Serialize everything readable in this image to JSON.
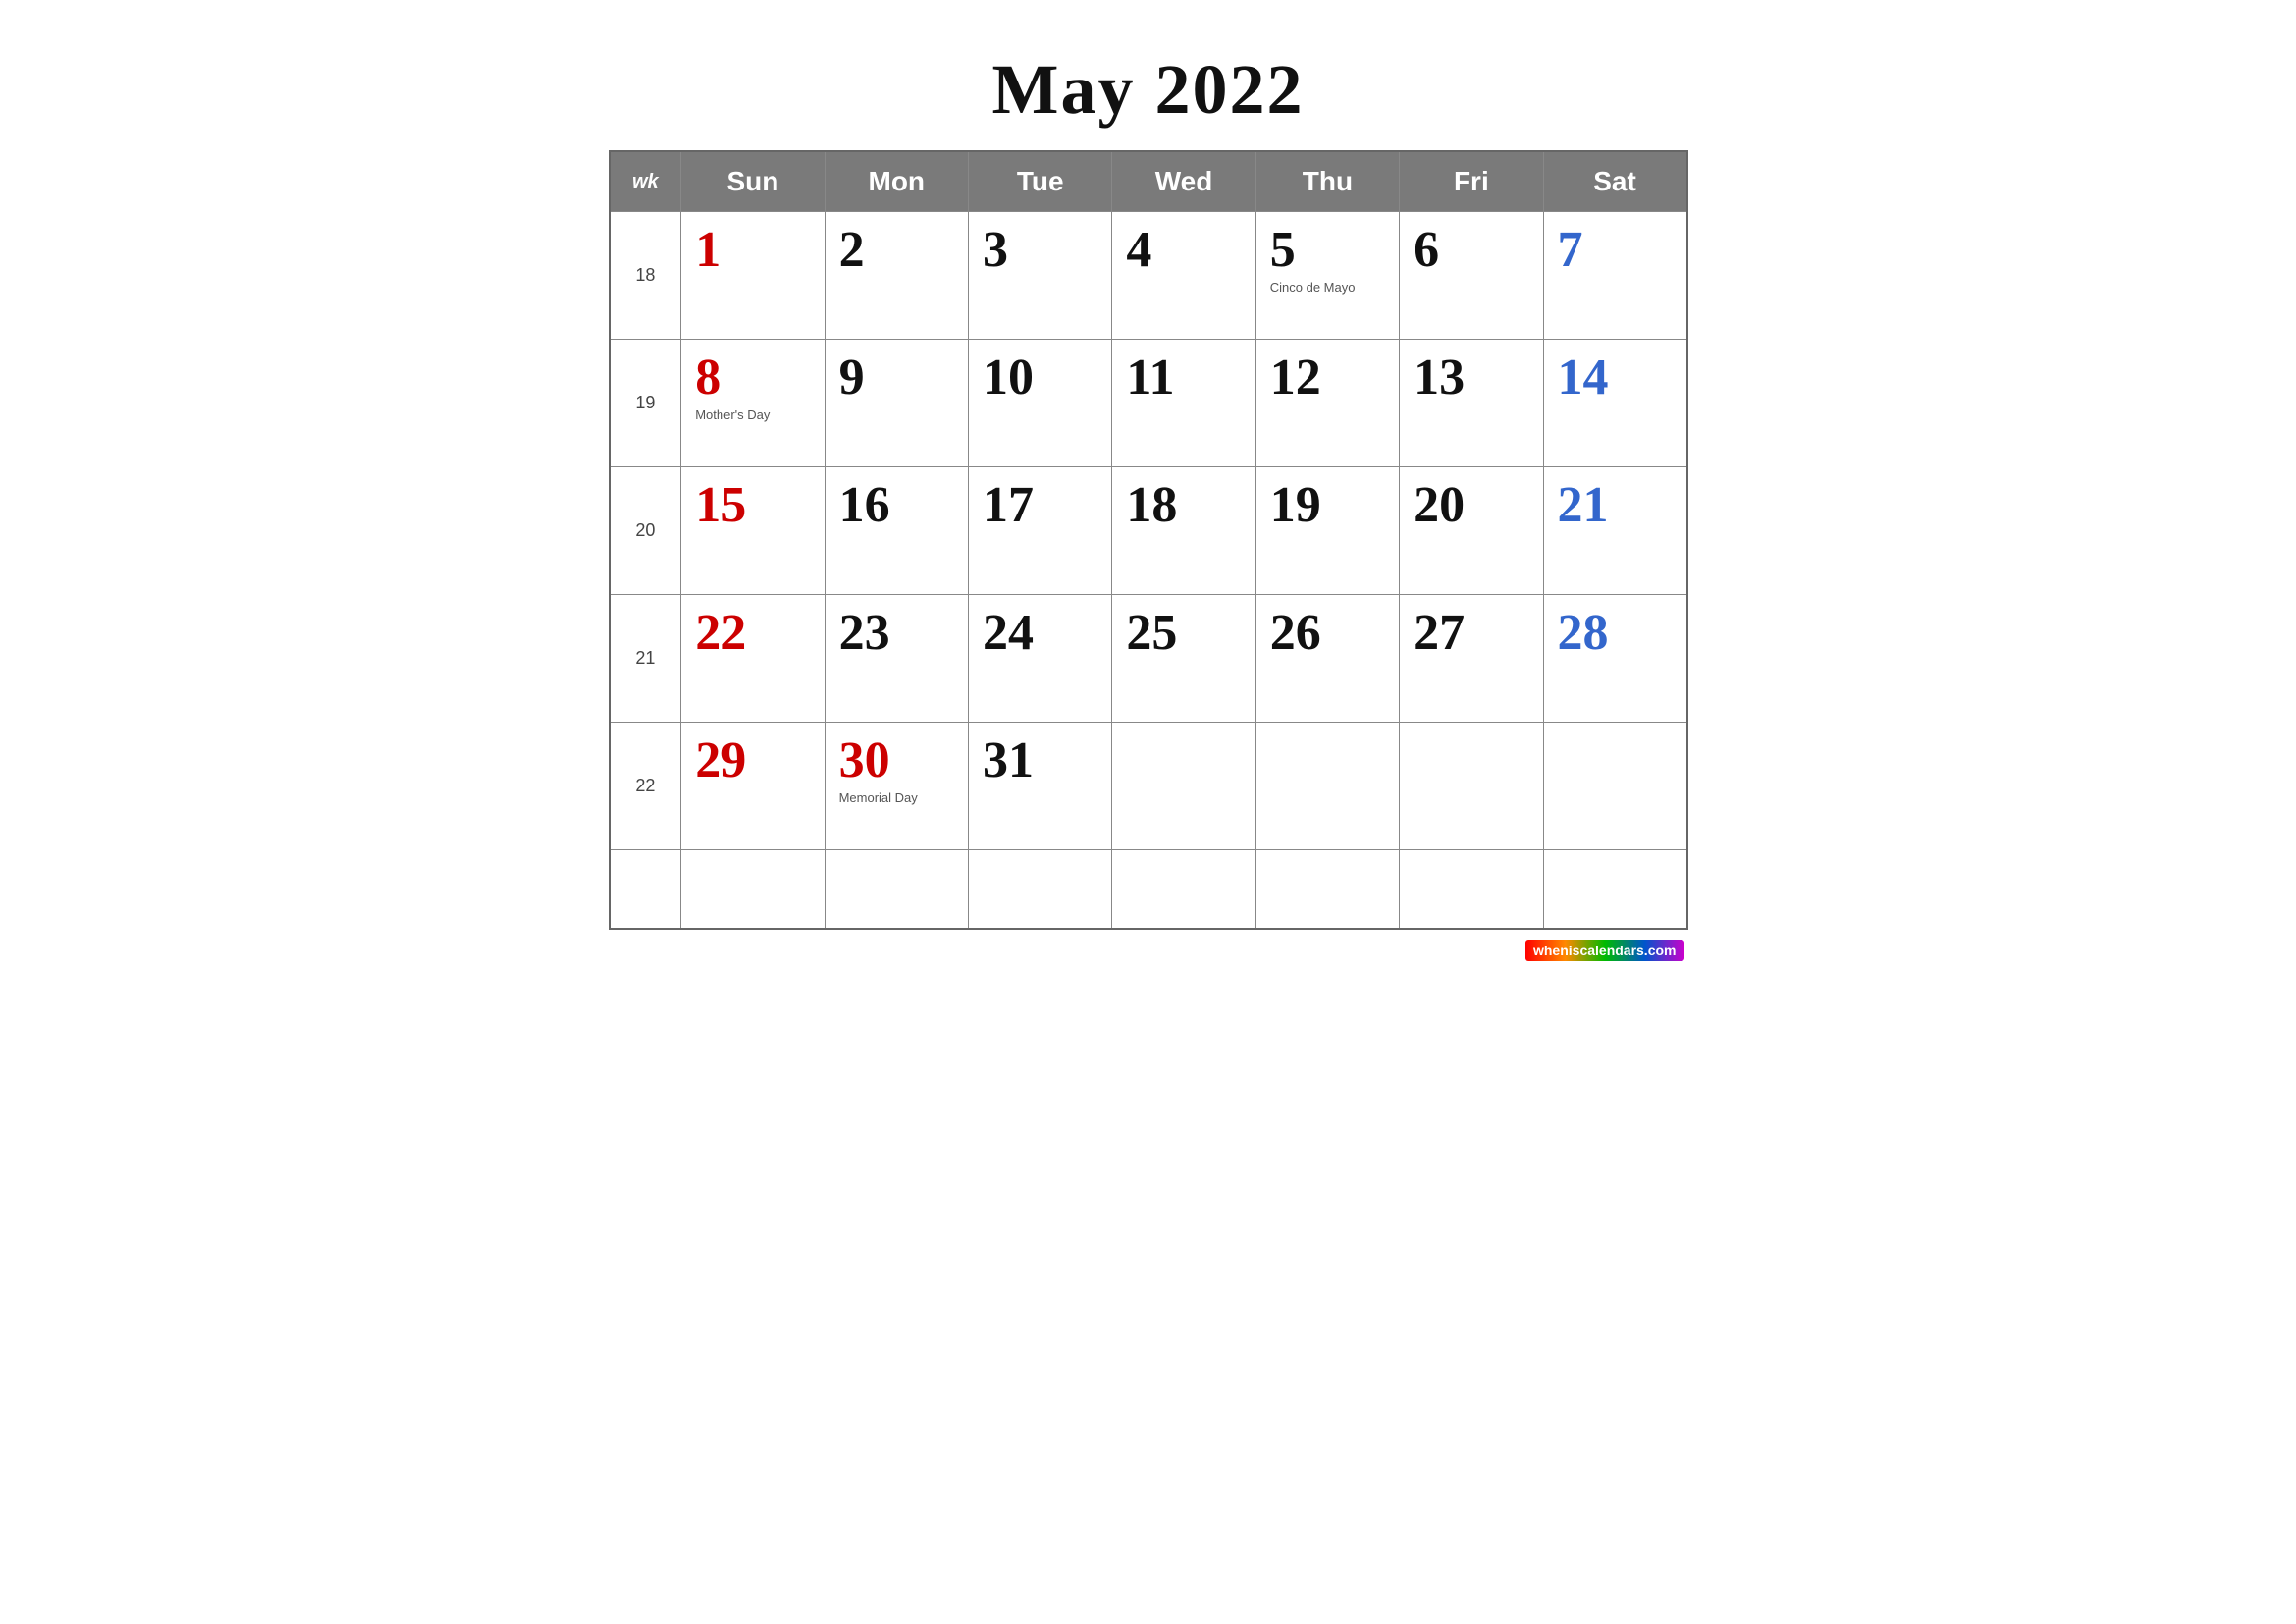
{
  "title": "May 2022",
  "headers": {
    "wk": "wk",
    "sun": "Sun",
    "mon": "Mon",
    "tue": "Tue",
    "wed": "Wed",
    "thu": "Thu",
    "fri": "Fri",
    "sat": "Sat"
  },
  "weeks": [
    {
      "wk": "18",
      "days": [
        {
          "num": "1",
          "type": "sunday",
          "holiday": ""
        },
        {
          "num": "2",
          "type": "weekday",
          "holiday": ""
        },
        {
          "num": "3",
          "type": "weekday",
          "holiday": ""
        },
        {
          "num": "4",
          "type": "weekday",
          "holiday": ""
        },
        {
          "num": "5",
          "type": "weekday",
          "holiday": "Cinco de Mayo"
        },
        {
          "num": "6",
          "type": "weekday",
          "holiday": ""
        },
        {
          "num": "7",
          "type": "saturday",
          "holiday": ""
        }
      ]
    },
    {
      "wk": "19",
      "days": [
        {
          "num": "8",
          "type": "sunday",
          "holiday": "Mother's Day"
        },
        {
          "num": "9",
          "type": "weekday",
          "holiday": ""
        },
        {
          "num": "10",
          "type": "weekday",
          "holiday": ""
        },
        {
          "num": "11",
          "type": "weekday",
          "holiday": ""
        },
        {
          "num": "12",
          "type": "weekday",
          "holiday": ""
        },
        {
          "num": "13",
          "type": "weekday",
          "holiday": ""
        },
        {
          "num": "14",
          "type": "saturday",
          "holiday": ""
        }
      ]
    },
    {
      "wk": "20",
      "days": [
        {
          "num": "15",
          "type": "sunday",
          "holiday": ""
        },
        {
          "num": "16",
          "type": "weekday",
          "holiday": ""
        },
        {
          "num": "17",
          "type": "weekday",
          "holiday": ""
        },
        {
          "num": "18",
          "type": "weekday",
          "holiday": ""
        },
        {
          "num": "19",
          "type": "weekday",
          "holiday": ""
        },
        {
          "num": "20",
          "type": "weekday",
          "holiday": ""
        },
        {
          "num": "21",
          "type": "saturday",
          "holiday": ""
        }
      ]
    },
    {
      "wk": "21",
      "days": [
        {
          "num": "22",
          "type": "sunday",
          "holiday": ""
        },
        {
          "num": "23",
          "type": "weekday",
          "holiday": ""
        },
        {
          "num": "24",
          "type": "weekday",
          "holiday": ""
        },
        {
          "num": "25",
          "type": "weekday",
          "holiday": ""
        },
        {
          "num": "26",
          "type": "weekday",
          "holiday": ""
        },
        {
          "num": "27",
          "type": "weekday",
          "holiday": ""
        },
        {
          "num": "28",
          "type": "saturday",
          "holiday": ""
        }
      ]
    },
    {
      "wk": "22",
      "days": [
        {
          "num": "29",
          "type": "sunday",
          "holiday": ""
        },
        {
          "num": "30",
          "type": "holiday",
          "holiday": "Memorial Day"
        },
        {
          "num": "31",
          "type": "weekday",
          "holiday": ""
        },
        {
          "num": "",
          "type": "empty",
          "holiday": ""
        },
        {
          "num": "",
          "type": "empty",
          "holiday": ""
        },
        {
          "num": "",
          "type": "empty",
          "holiday": ""
        },
        {
          "num": "",
          "type": "empty",
          "holiday": ""
        }
      ]
    }
  ],
  "watermark": "wheniscalendars.com"
}
